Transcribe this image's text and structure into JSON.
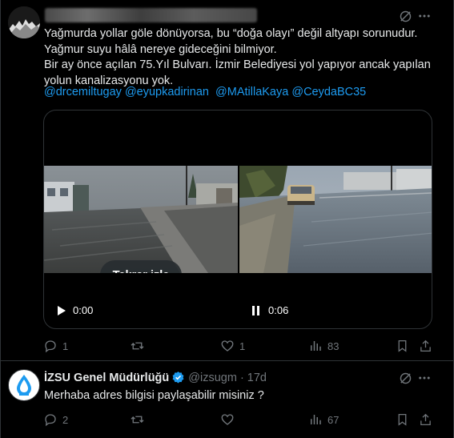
{
  "tweet": {
    "lines": [
      "Yağmurda yollar göle dönüyorsa, bu “doğa olayı” değil altyapı sorunudur.",
      "Yağmur suyu hâlâ nereye gideceğini bilmiyor.",
      "Bir ay önce açılan 75.Yıl Bulvarı. İzmir Belediyesi yol yapıyor ancak yapılan",
      "yolun kanalizasyonu yok."
    ],
    "mentions": [
      "@drcemiltugay",
      "@eyupkadirinan",
      "@MAtillaKaya",
      "@CeydaBC35"
    ],
    "video": {
      "replay_label": "Tekrar izle",
      "left_time": "0:00",
      "right_time": "0:06"
    },
    "actions": {
      "replies": "1",
      "likes": "1",
      "views": "83"
    }
  },
  "reply": {
    "name": "İZSU Genel Müdürlüğü",
    "handle": "@izsugm",
    "time": "17d",
    "text": "Merhaba adres bilgisi paylaşabilir misiniz ?",
    "actions": {
      "replies": "2",
      "views": "67"
    }
  },
  "colors": {
    "background": "#000000",
    "text": "#e7e9ea",
    "muted": "#71767b",
    "link": "#1d9bf0",
    "verified": "#1d9bf0"
  }
}
